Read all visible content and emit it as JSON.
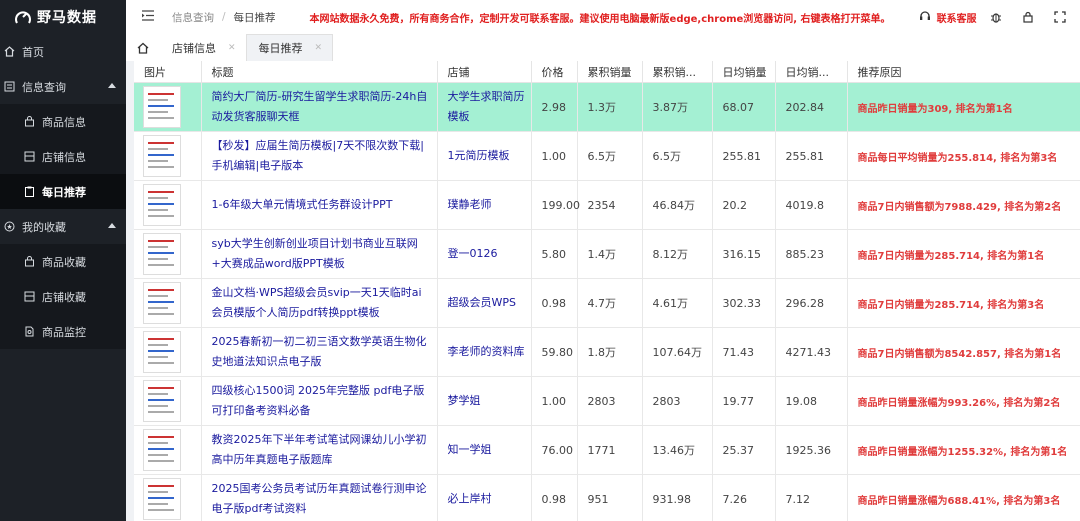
{
  "app": {
    "title": "野马数据"
  },
  "sidebar": {
    "items": [
      {
        "label": "首页",
        "icon": "home-icon"
      },
      {
        "label": "信息查询",
        "icon": "list-icon"
      },
      {
        "label": "商品信息",
        "icon": "bag-icon"
      },
      {
        "label": "店铺信息",
        "icon": "store-icon"
      },
      {
        "label": "每日推荐",
        "icon": "clipboard-icon"
      },
      {
        "label": "我的收藏",
        "icon": "star-icon"
      },
      {
        "label": "商品收藏",
        "icon": "bag-icon"
      },
      {
        "label": "店铺收藏",
        "icon": "store-icon"
      },
      {
        "label": "商品监控",
        "icon": "monitor-icon"
      }
    ]
  },
  "header": {
    "breadcrumb": [
      "信息查询",
      "每日推荐"
    ],
    "notice": "本网站数据永久免费，所有商务合作，定制开发可联系客服。建议使用电脑最新版edge,chrome浏览器访问, 右键表格打开菜单。",
    "support_label": "联系客服"
  },
  "tabs": [
    "店铺信息",
    "每日推荐"
  ],
  "table": {
    "columns": [
      "图片",
      "标题",
      "店铺",
      "价格",
      "累积销量",
      "累积销...",
      "日均销量",
      "日均销...",
      "推荐原因"
    ],
    "rows": [
      {
        "title": "简约大厂简历-研究生留学生求职简历-24h自动发货客服聊天框",
        "shop": "大学生求职简历模板",
        "price": "2.98",
        "cum_sales": "1.3万",
        "cum_amount": "3.87万",
        "daily_sales": "68.07",
        "daily_amount": "202.84",
        "reason": "商品昨日销量为309, 排名为第1名"
      },
      {
        "title": "【秒发】应届生简历模板|7天不限次数下载|手机编辑|电子版本",
        "shop": "1元简历模板",
        "price": "1.00",
        "cum_sales": "6.5万",
        "cum_amount": "6.5万",
        "daily_sales": "255.81",
        "daily_amount": "255.81",
        "reason": "商品每日平均销量为255.814, 排名为第3名"
      },
      {
        "title": "1-6年级大单元情境式任务群设计PPT",
        "shop": "璞静老师",
        "price": "199.00",
        "cum_sales": "2354",
        "cum_amount": "46.84万",
        "daily_sales": "20.2",
        "daily_amount": "4019.8",
        "reason": "商品7日内销售额为7988.429, 排名为第2名"
      },
      {
        "title": "syb大学生创新创业项目计划书商业互联网+大赛成品word版PPT模板",
        "shop": "登一0126",
        "price": "5.80",
        "cum_sales": "1.4万",
        "cum_amount": "8.12万",
        "daily_sales": "316.15",
        "daily_amount": "885.23",
        "reason": "商品7日内销量为285.714, 排名为第1名"
      },
      {
        "title": "金山文档·WPS超级会员svip一天1天临时ai会员模版个人简历pdf转换ppt模板",
        "shop": "超级会员WPS",
        "price": "0.98",
        "cum_sales": "4.7万",
        "cum_amount": "4.61万",
        "daily_sales": "302.33",
        "daily_amount": "296.28",
        "reason": "商品7日内销量为285.714, 排名为第3名"
      },
      {
        "title": "2025春新初一初二初三语文数学英语生物化史地道法知识点电子版",
        "shop": "李老师的资料库",
        "price": "59.80",
        "cum_sales": "1.8万",
        "cum_amount": "107.64万",
        "daily_sales": "71.43",
        "daily_amount": "4271.43",
        "reason": "商品7日内销售额为8542.857, 排名为第1名"
      },
      {
        "title": "四级核心1500词 2025年完整版 pdf电子版可打印备考资料必备",
        "shop": "梦学姐",
        "price": "1.00",
        "cum_sales": "2803",
        "cum_amount": "2803",
        "daily_sales": "19.77",
        "daily_amount": "19.08",
        "reason": "商品昨日销量涨幅为993.26%, 排名为第2名"
      },
      {
        "title": "教资2025年下半年考试笔试网课幼儿小学初高中历年真题电子版题库",
        "shop": "知一学姐",
        "price": "76.00",
        "cum_sales": "1771",
        "cum_amount": "13.46万",
        "daily_sales": "25.37",
        "daily_amount": "1925.36",
        "reason": "商品昨日销量涨幅为1255.32%, 排名为第1名"
      },
      {
        "title": "2025国考公务员考试历年真题试卷行测申论电子版pdf考试资料",
        "shop": "必上岸村",
        "price": "0.98",
        "cum_sales": "951",
        "cum_amount": "931.98",
        "daily_sales": "7.26",
        "daily_amount": "7.12",
        "reason": "商品昨日销量涨幅为688.41%, 排名为第3名"
      }
    ]
  },
  "colors": {
    "sidebar_bg": "#1d2127",
    "highlight_row": "#a4f0d3",
    "reason_red": "#e03c3c",
    "link_blue": "#1a1a9e"
  }
}
